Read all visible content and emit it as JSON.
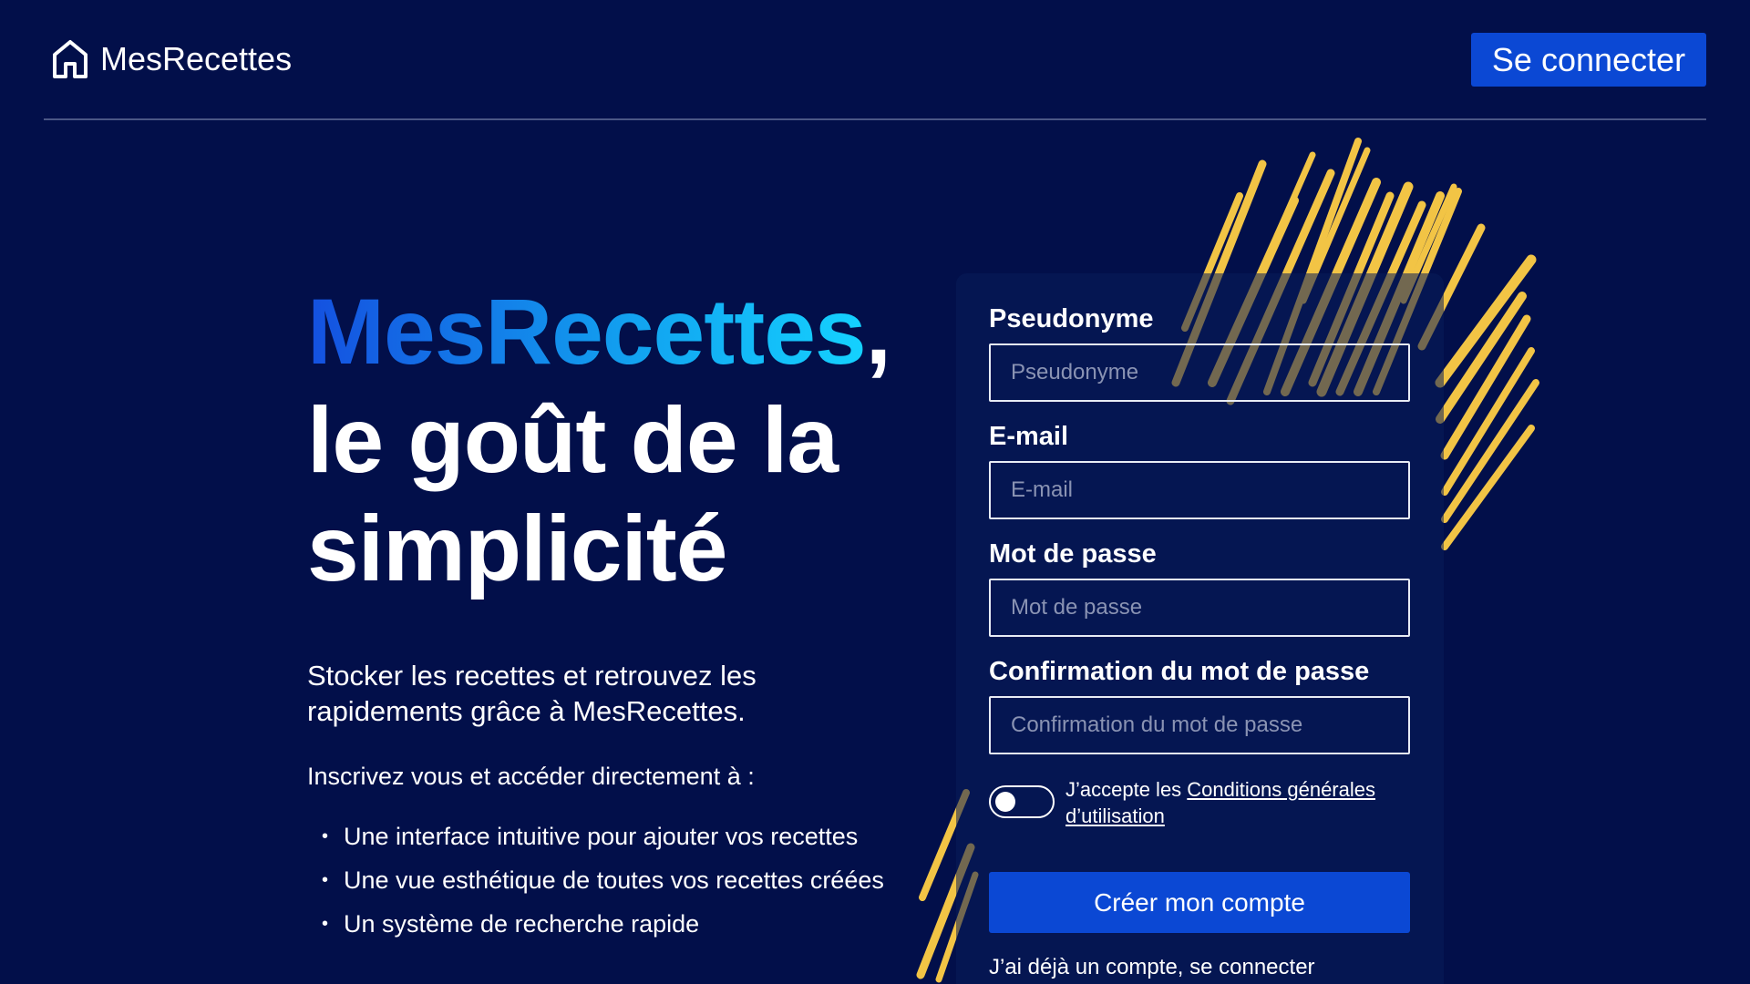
{
  "header": {
    "logo_icon": "home-icon",
    "logo_text": "MesRecettes",
    "login_label": "Se connecter"
  },
  "hero": {
    "title_brand": "MesRecettes",
    "title_comma": ",",
    "title_line2": "le goût de la",
    "title_line3": "simplicité",
    "description_line1": "Stocker les recettes et retrouvez les",
    "description_line2": "rapidements grâce à MesRecettes.",
    "intro": "Inscrivez vous et accéder directement à :",
    "features": [
      "Une interface intuitive pour ajouter vos recettes",
      "Une vue esthétique de toutes vos recettes créées",
      "Un système de recherche rapide"
    ]
  },
  "form": {
    "pseudo_label": "Pseudonyme",
    "pseudo_placeholder": "Pseudonyme",
    "email_label": "E-mail",
    "email_placeholder": "E-mail",
    "password_label": "Mot de passe",
    "password_placeholder": "Mot de passe",
    "confirm_label": "Confirmation du mot de passe",
    "confirm_placeholder": "Confirmation du mot de passe",
    "terms_prefix": "J’accepte les ",
    "terms_link_line1": "Conditions générales",
    "terms_link_line2": "d’utilisation",
    "terms_accepted": false,
    "submit_label": "Créer mon compte",
    "already_account": "J’ai déjà un compte, se connecter"
  },
  "colors": {
    "background": "#020f4a",
    "primary_button": "#0b48d4",
    "brand_gradient_start": "#1450e0",
    "brand_gradient_end": "#14d2ff",
    "pasta": "#f2c445"
  }
}
